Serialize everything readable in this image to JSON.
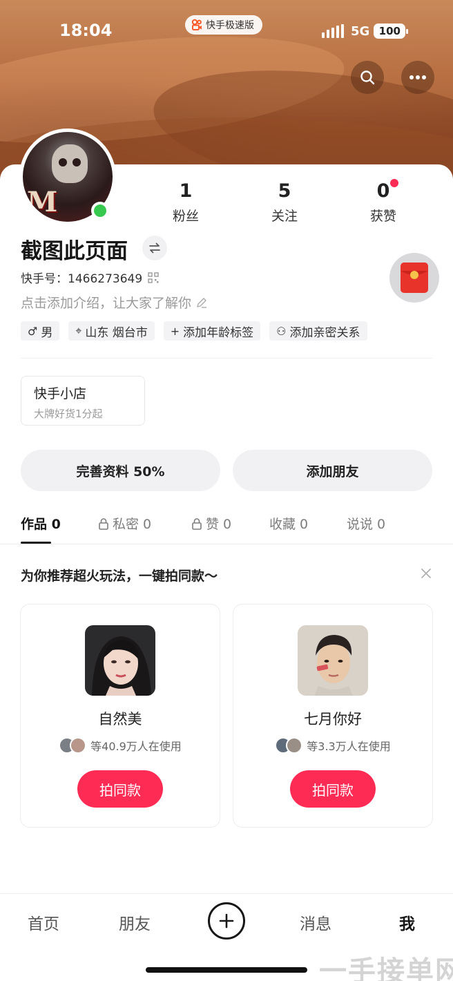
{
  "status_bar": {
    "time": "18:04",
    "app_badge": "快手极速版",
    "network": "5G",
    "battery": "100"
  },
  "profile": {
    "name": "截图此页面",
    "kuaishou_id": "快手号：1466273649",
    "intro_placeholder": "点击添加介绍，让大家了解你",
    "avatar_text": "M",
    "stats": [
      {
        "value": "1",
        "label": "粉丝"
      },
      {
        "value": "5",
        "label": "关注"
      },
      {
        "value": "0",
        "label": "获赞"
      }
    ],
    "tags": [
      {
        "icon": "♂",
        "text": "男"
      },
      {
        "icon": "⌖",
        "text": "山东 烟台市"
      },
      {
        "icon": "+",
        "text": "添加年龄标签"
      },
      {
        "icon": "⚇",
        "text": "添加亲密关系"
      }
    ]
  },
  "shop": {
    "title": "快手小店",
    "subtitle": "大牌好货1分起"
  },
  "actions": {
    "complete_profile": "完善资料 50%",
    "add_friend": "添加朋友"
  },
  "tabs": [
    {
      "label": "作品 0",
      "locked": false,
      "active": true
    },
    {
      "label": "私密 0",
      "locked": true,
      "active": false
    },
    {
      "label": "赞 0",
      "locked": true,
      "active": false
    },
    {
      "label": "收藏 0",
      "locked": false,
      "active": false
    },
    {
      "label": "说说 0",
      "locked": false,
      "active": false
    }
  ],
  "recommend": {
    "title": "为你推荐超火玩法，一键拍同款～",
    "cards": [
      {
        "name": "自然美",
        "users_text": "等40.9万人在使用",
        "cta": "拍同款"
      },
      {
        "name": "七月你好",
        "users_text": "等3.3万人在使用",
        "cta": "拍同款"
      }
    ]
  },
  "bottom_nav": {
    "home": "首页",
    "friends": "朋友",
    "messages": "消息",
    "me": "我"
  },
  "watermark": "一手接单网",
  "colors": {
    "accent": "#fe2c55",
    "online": "#37c94f"
  }
}
